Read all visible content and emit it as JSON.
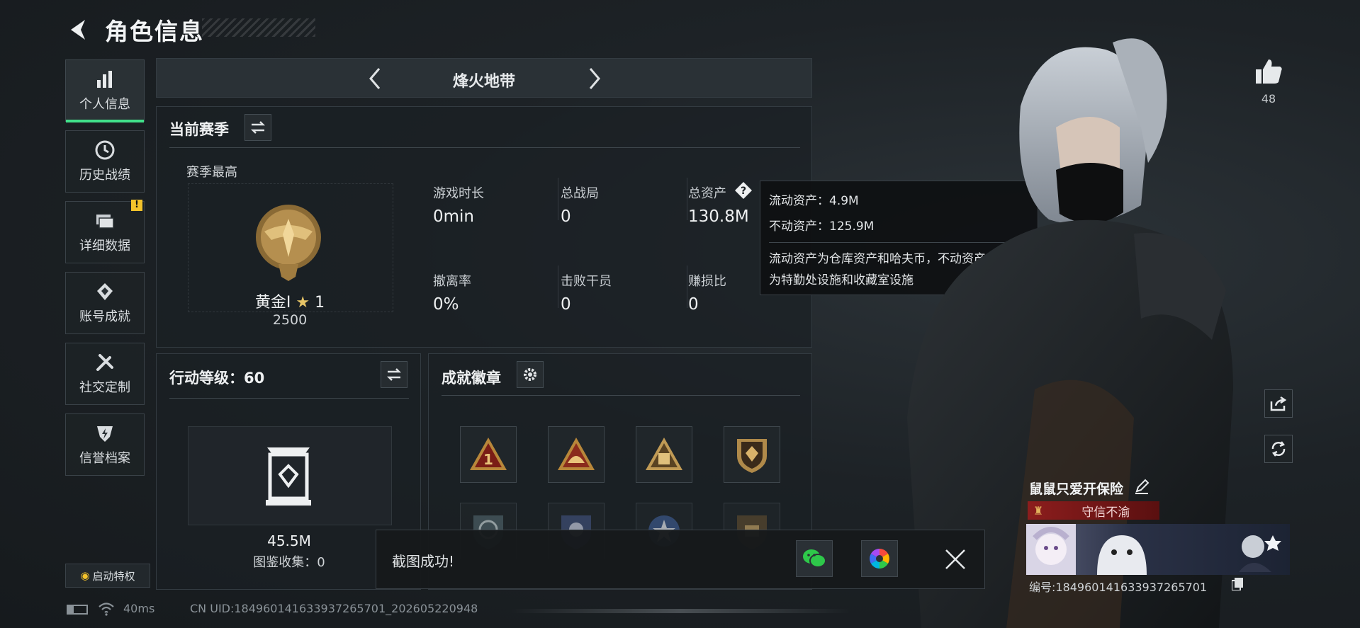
{
  "header": {
    "title": "角色信息"
  },
  "nav": {
    "items": [
      {
        "label": "个人信息",
        "icon": "bar-chart-icon",
        "active": true
      },
      {
        "label": "历史战绩",
        "icon": "clock-icon"
      },
      {
        "label": "详细数据",
        "icon": "folders-icon",
        "badge": "!"
      },
      {
        "label": "账号成就",
        "icon": "achievement-icon"
      },
      {
        "label": "社交定制",
        "icon": "tools-icon"
      },
      {
        "label": "信誉档案",
        "icon": "shield-bolt-icon"
      }
    ],
    "privilege_label": "启动特权"
  },
  "mode": {
    "title": "烽火地带"
  },
  "season": {
    "title": "当前赛季",
    "best_label": "赛季最高",
    "rank_name": "黄金I",
    "rank_stars": "1",
    "rank_points": "2500",
    "stats": [
      {
        "label": "游戏时长",
        "value": "0min"
      },
      {
        "label": "总战局",
        "value": "0"
      },
      {
        "label": "总资产",
        "value": "130.8M"
      },
      {
        "label": "撤离率",
        "value": "0%"
      },
      {
        "label": "击败干员",
        "value": "0"
      },
      {
        "label": "赚损比",
        "value": "0"
      }
    ]
  },
  "tooltip": {
    "liquid": "流动资产：4.9M",
    "fixed": "不动资产：125.9M",
    "desc_line1": "流动资产为仓库资产和哈夫币，不动资产",
    "desc_line2": "为特勤处设施和收藏室设施"
  },
  "level": {
    "title": "行动等级：60",
    "value": "45.5M",
    "collection": "图鉴收集：0"
  },
  "achievements": {
    "title": "成就徽章"
  },
  "toast": {
    "message": "截图成功!"
  },
  "profile": {
    "likes": "48",
    "name": "鼠鼠只爱开保险",
    "tag": "守信不渝",
    "uid_label": "编号:184960141633937265701"
  },
  "status": {
    "ping": "40ms",
    "uid": "CN UID:184960141633937265701_202605220948"
  },
  "colors": {
    "accent": "#41e08a",
    "warn": "#f3c22b",
    "tag_red": "#8c1d1d"
  }
}
